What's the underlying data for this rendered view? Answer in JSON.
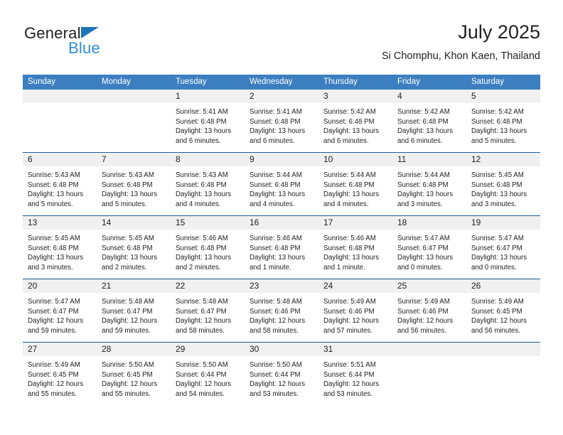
{
  "logo": {
    "word1": "General",
    "word2": "Blue",
    "triangle_color": "#1c74bb",
    "blue_color": "#2f8fd6"
  },
  "header": {
    "title": "July 2025",
    "subtitle": "Si Chomphu, Khon Kaen, Thailand"
  },
  "theme": {
    "header_bar": "#3c7fc0",
    "week_rule": "#1f5c99",
    "daynum_band": "#f0f0f0",
    "text": "#222222"
  },
  "calendar": {
    "day_names": [
      "Sunday",
      "Monday",
      "Tuesday",
      "Wednesday",
      "Thursday",
      "Friday",
      "Saturday"
    ],
    "weeks": [
      [
        {
          "day": "",
          "lines": []
        },
        {
          "day": "",
          "lines": []
        },
        {
          "day": "1",
          "lines": [
            "Sunrise: 5:41 AM",
            "Sunset: 6:48 PM",
            "Daylight: 13 hours",
            "and 6 minutes."
          ]
        },
        {
          "day": "2",
          "lines": [
            "Sunrise: 5:41 AM",
            "Sunset: 6:48 PM",
            "Daylight: 13 hours",
            "and 6 minutes."
          ]
        },
        {
          "day": "3",
          "lines": [
            "Sunrise: 5:42 AM",
            "Sunset: 6:48 PM",
            "Daylight: 13 hours",
            "and 6 minutes."
          ]
        },
        {
          "day": "4",
          "lines": [
            "Sunrise: 5:42 AM",
            "Sunset: 6:48 PM",
            "Daylight: 13 hours",
            "and 6 minutes."
          ]
        },
        {
          "day": "5",
          "lines": [
            "Sunrise: 5:42 AM",
            "Sunset: 6:48 PM",
            "Daylight: 13 hours",
            "and 5 minutes."
          ]
        }
      ],
      [
        {
          "day": "6",
          "lines": [
            "Sunrise: 5:43 AM",
            "Sunset: 6:48 PM",
            "Daylight: 13 hours",
            "and 5 minutes."
          ]
        },
        {
          "day": "7",
          "lines": [
            "Sunrise: 5:43 AM",
            "Sunset: 6:48 PM",
            "Daylight: 13 hours",
            "and 5 minutes."
          ]
        },
        {
          "day": "8",
          "lines": [
            "Sunrise: 5:43 AM",
            "Sunset: 6:48 PM",
            "Daylight: 13 hours",
            "and 4 minutes."
          ]
        },
        {
          "day": "9",
          "lines": [
            "Sunrise: 5:44 AM",
            "Sunset: 6:48 PM",
            "Daylight: 13 hours",
            "and 4 minutes."
          ]
        },
        {
          "day": "10",
          "lines": [
            "Sunrise: 5:44 AM",
            "Sunset: 6:48 PM",
            "Daylight: 13 hours",
            "and 4 minutes."
          ]
        },
        {
          "day": "11",
          "lines": [
            "Sunrise: 5:44 AM",
            "Sunset: 6:48 PM",
            "Daylight: 13 hours",
            "and 3 minutes."
          ]
        },
        {
          "day": "12",
          "lines": [
            "Sunrise: 5:45 AM",
            "Sunset: 6:48 PM",
            "Daylight: 13 hours",
            "and 3 minutes."
          ]
        }
      ],
      [
        {
          "day": "13",
          "lines": [
            "Sunrise: 5:45 AM",
            "Sunset: 6:48 PM",
            "Daylight: 13 hours",
            "and 3 minutes."
          ]
        },
        {
          "day": "14",
          "lines": [
            "Sunrise: 5:45 AM",
            "Sunset: 6:48 PM",
            "Daylight: 13 hours",
            "and 2 minutes."
          ]
        },
        {
          "day": "15",
          "lines": [
            "Sunrise: 5:46 AM",
            "Sunset: 6:48 PM",
            "Daylight: 13 hours",
            "and 2 minutes."
          ]
        },
        {
          "day": "16",
          "lines": [
            "Sunrise: 5:46 AM",
            "Sunset: 6:48 PM",
            "Daylight: 13 hours",
            "and 1 minute."
          ]
        },
        {
          "day": "17",
          "lines": [
            "Sunrise: 5:46 AM",
            "Sunset: 6:48 PM",
            "Daylight: 13 hours",
            "and 1 minute."
          ]
        },
        {
          "day": "18",
          "lines": [
            "Sunrise: 5:47 AM",
            "Sunset: 6:47 PM",
            "Daylight: 13 hours",
            "and 0 minutes."
          ]
        },
        {
          "day": "19",
          "lines": [
            "Sunrise: 5:47 AM",
            "Sunset: 6:47 PM",
            "Daylight: 13 hours",
            "and 0 minutes."
          ]
        }
      ],
      [
        {
          "day": "20",
          "lines": [
            "Sunrise: 5:47 AM",
            "Sunset: 6:47 PM",
            "Daylight: 12 hours",
            "and 59 minutes."
          ]
        },
        {
          "day": "21",
          "lines": [
            "Sunrise: 5:48 AM",
            "Sunset: 6:47 PM",
            "Daylight: 12 hours",
            "and 59 minutes."
          ]
        },
        {
          "day": "22",
          "lines": [
            "Sunrise: 5:48 AM",
            "Sunset: 6:47 PM",
            "Daylight: 12 hours",
            "and 58 minutes."
          ]
        },
        {
          "day": "23",
          "lines": [
            "Sunrise: 5:48 AM",
            "Sunset: 6:46 PM",
            "Daylight: 12 hours",
            "and 58 minutes."
          ]
        },
        {
          "day": "24",
          "lines": [
            "Sunrise: 5:49 AM",
            "Sunset: 6:46 PM",
            "Daylight: 12 hours",
            "and 57 minutes."
          ]
        },
        {
          "day": "25",
          "lines": [
            "Sunrise: 5:49 AM",
            "Sunset: 6:46 PM",
            "Daylight: 12 hours",
            "and 56 minutes."
          ]
        },
        {
          "day": "26",
          "lines": [
            "Sunrise: 5:49 AM",
            "Sunset: 6:45 PM",
            "Daylight: 12 hours",
            "and 56 minutes."
          ]
        }
      ],
      [
        {
          "day": "27",
          "lines": [
            "Sunrise: 5:49 AM",
            "Sunset: 6:45 PM",
            "Daylight: 12 hours",
            "and 55 minutes."
          ]
        },
        {
          "day": "28",
          "lines": [
            "Sunrise: 5:50 AM",
            "Sunset: 6:45 PM",
            "Daylight: 12 hours",
            "and 55 minutes."
          ]
        },
        {
          "day": "29",
          "lines": [
            "Sunrise: 5:50 AM",
            "Sunset: 6:44 PM",
            "Daylight: 12 hours",
            "and 54 minutes."
          ]
        },
        {
          "day": "30",
          "lines": [
            "Sunrise: 5:50 AM",
            "Sunset: 6:44 PM",
            "Daylight: 12 hours",
            "and 53 minutes."
          ]
        },
        {
          "day": "31",
          "lines": [
            "Sunrise: 5:51 AM",
            "Sunset: 6:44 PM",
            "Daylight: 12 hours",
            "and 53 minutes."
          ]
        },
        {
          "day": "",
          "lines": []
        },
        {
          "day": "",
          "lines": []
        }
      ]
    ]
  }
}
